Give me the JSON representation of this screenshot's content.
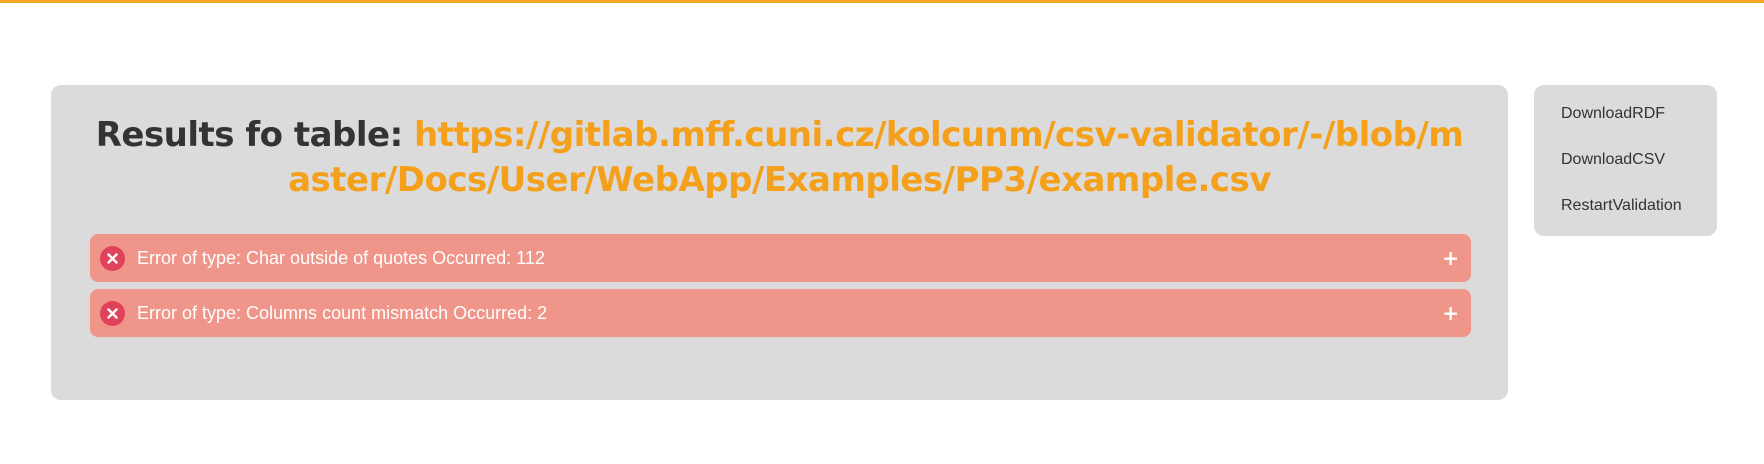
{
  "results": {
    "title_prefix": "Results fo table: ",
    "table_url": "https://gitlab.mff.cuni.cz/kolcunm/csv-validator/-/blob/master/Docs/User/WebApp/Examples/PP3/example.csv",
    "errors": [
      {
        "text": "Error of type: Char outside of quotes Occurred: 112",
        "expand": "+"
      },
      {
        "text": "Error of type: Columns count mismatch Occurred: 2",
        "expand": "+"
      }
    ]
  },
  "sidebar": {
    "items": [
      {
        "label": "DownloadRDF"
      },
      {
        "label": "DownloadCSV"
      },
      {
        "label": "RestartValidation"
      }
    ]
  },
  "colors": {
    "accent": "#f5a01a",
    "panel": "#dbdbdb",
    "error_row": "#f0958a",
    "error_icon": "#e0425a"
  }
}
